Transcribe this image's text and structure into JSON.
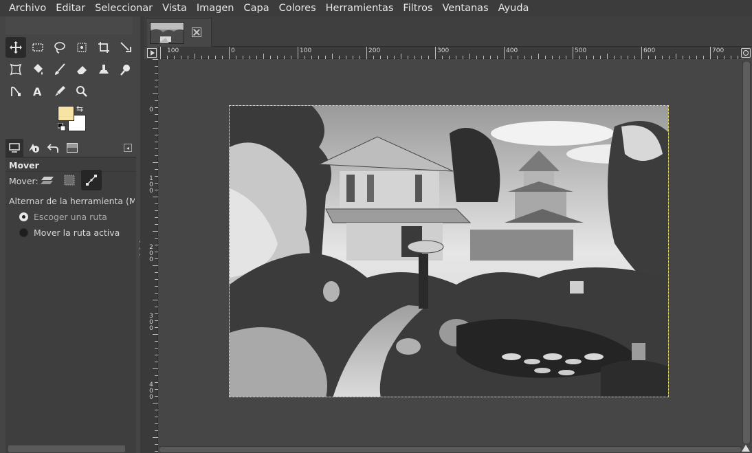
{
  "menubar": {
    "items": [
      "Archivo",
      "Editar",
      "Seleccionar",
      "Vista",
      "Imagen",
      "Capa",
      "Colores",
      "Herramientas",
      "Filtros",
      "Ventanas",
      "Ayuda"
    ]
  },
  "toolbox": {
    "tools": [
      {
        "icon": "move-icon",
        "active": true
      },
      {
        "icon": "rect-select-icon",
        "active": false
      },
      {
        "icon": "free-select-icon",
        "active": false
      },
      {
        "icon": "fuzzy-select-icon",
        "active": false
      },
      {
        "icon": "crop-icon",
        "active": false
      },
      {
        "icon": "unified-transform-icon",
        "active": false
      },
      {
        "icon": "warp-transform-icon",
        "active": false
      },
      {
        "icon": "bucket-fill-icon",
        "active": false
      },
      {
        "icon": "paintbrush-icon",
        "active": false
      },
      {
        "icon": "eraser-icon",
        "active": false
      },
      {
        "icon": "clone-icon",
        "active": false
      },
      {
        "icon": "smudge-icon",
        "active": false
      },
      {
        "icon": "paths-icon",
        "active": false
      },
      {
        "icon": "text-icon",
        "active": false
      },
      {
        "icon": "color-picker-icon",
        "active": false
      },
      {
        "icon": "zoom-icon",
        "active": false
      }
    ],
    "foreground_color": "#f7e4a5",
    "background_color": "#ffffff"
  },
  "dock_tabs": [
    "tool-options-icon",
    "device-status-icon",
    "undo-history-icon",
    "images-icon"
  ],
  "tool_options": {
    "title": "Mover",
    "mover_label": "Mover:",
    "toggle_label": "Alternar de la herramienta  (Mayús)",
    "radio_pick": "Escoger una ruta",
    "radio_active": "Mover la ruta activa"
  },
  "rulers": {
    "horizontal": [
      "100",
      "0",
      "100",
      "200",
      "300",
      "400",
      "500",
      "600",
      "700"
    ],
    "vertical": [
      "0",
      "100",
      "200",
      "300",
      "400"
    ]
  }
}
